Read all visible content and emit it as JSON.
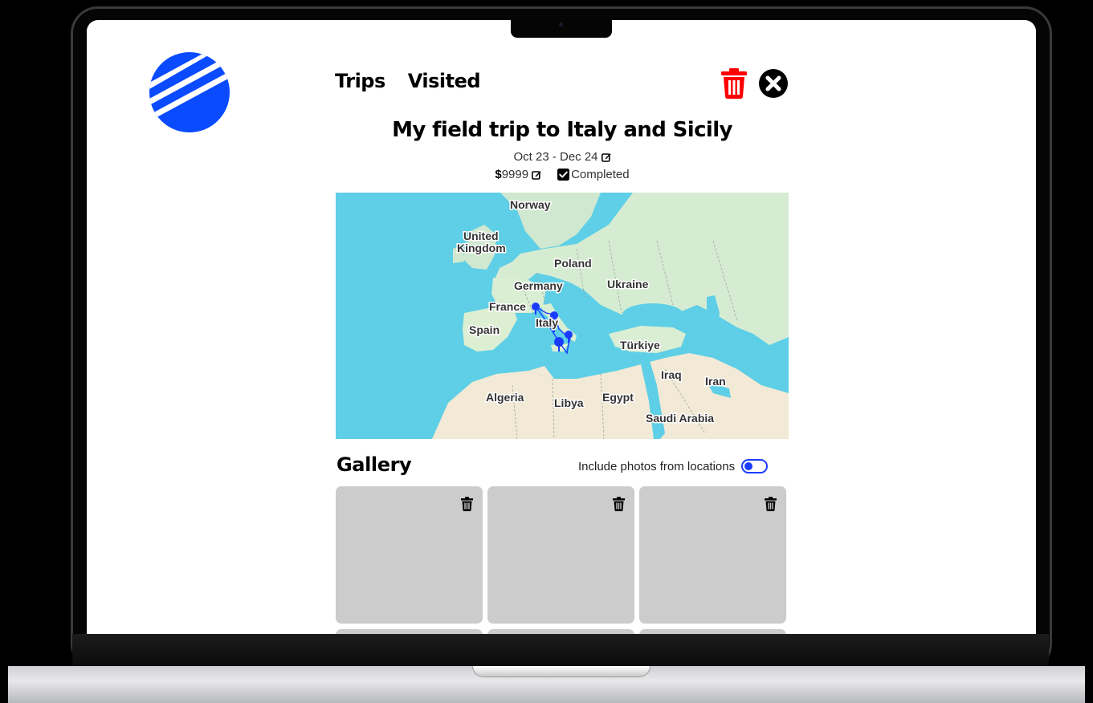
{
  "app": {
    "nav": {
      "trips": "Trips",
      "visited": "Visited"
    },
    "brand_color": "#0a4bff",
    "icons": {
      "delete_trip": "trash-icon",
      "close": "close-circle-icon",
      "edit": "edit-icon",
      "checkbox": "checkbox-checked-icon",
      "delete_photo": "trash-icon"
    }
  },
  "trip": {
    "title": "My field trip to Italy and Sicily",
    "dates": "Oct 23 - Dec 24",
    "budget_symbol": "$",
    "budget_value": "9999",
    "status": "Completed",
    "completed": true
  },
  "map": {
    "labels": [
      "Norway",
      "United",
      "Kingdom",
      "Poland",
      "Germany",
      "Ukraine",
      "France",
      "Italy",
      "Spain",
      "Türkiye",
      "Iraq",
      "Iran",
      "Algeria",
      "Libya",
      "Egypt",
      "Saudi Arabia"
    ],
    "marker_count": 5,
    "colors": {
      "sea": "#5ecfe6",
      "land": "#d6ecd2",
      "route": "#1a3cff"
    }
  },
  "gallery": {
    "title": "Gallery",
    "toggle_label": "Include photos from locations",
    "toggle_on": true,
    "tiles": [
      "photo-1",
      "photo-2",
      "photo-3"
    ]
  },
  "colors": {
    "danger": "#ff0000",
    "tile": "#cccccc",
    "toggle": "#1a3cff"
  }
}
